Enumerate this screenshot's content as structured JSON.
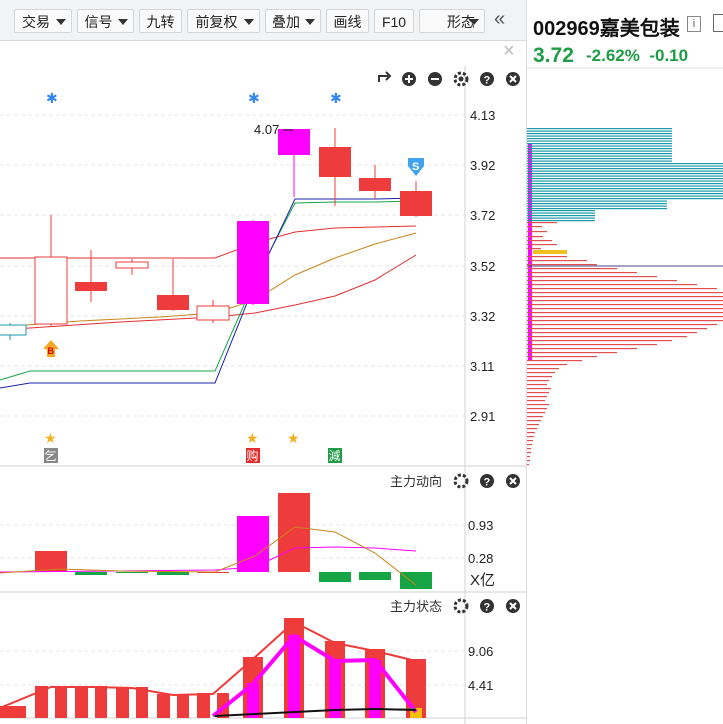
{
  "toolbar": {
    "buttons": [
      "交易",
      "信号",
      "九转",
      "前复权",
      "叠加",
      "画线",
      "F10",
      "形态"
    ],
    "collapse": "«",
    "close": "×"
  },
  "stock": {
    "code_name": "002969嘉美包装",
    "info": "i",
    "price": "3.72",
    "change_pct": "-2.62%",
    "change": "-0.10"
  },
  "kline_panel": {
    "price_ticks": [
      "4.13",
      "3.92",
      "3.72",
      "3.52",
      "3.32",
      "3.11",
      "2.91"
    ],
    "high_label": "4.07",
    "markers": [
      "B",
      "S"
    ],
    "badges": [
      "乞",
      "购",
      "減"
    ],
    "controls": [
      "rotate-icon",
      "zoom-in-icon",
      "zoom-out-icon",
      "settings-icon",
      "help-icon",
      "close-icon"
    ]
  },
  "flow_panel": {
    "title": "主力动向",
    "ticks": [
      "0.93",
      "0.28"
    ],
    "unit": "X亿"
  },
  "state_panel": {
    "title": "主力状态",
    "ticks": [
      "9.06",
      "4.41"
    ]
  },
  "colors": {
    "up": "#ee3b3b",
    "down": "#17a444",
    "magenta": "#ff00ff",
    "cyan": "#1b9aa8"
  }
}
